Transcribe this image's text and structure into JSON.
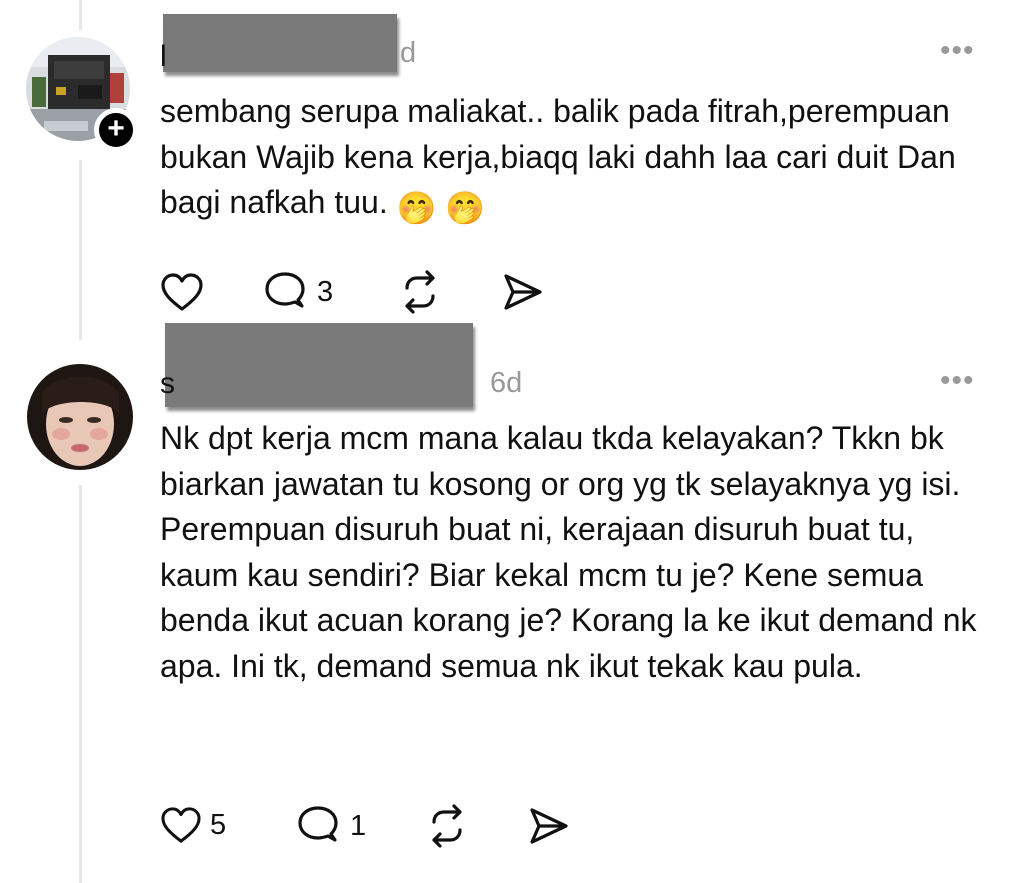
{
  "posts": [
    {
      "username_tail": "l",
      "timestamp": "d",
      "more_label": "•••",
      "text": "sembang serupa maliakat.. balik pada fitrah,perempuan bukan Wajib kena kerja,biaqq laki dahh laa cari duit Dan bagi nafkah tuu.",
      "emoji": [
        "🤭",
        "🤭"
      ],
      "follow_label": "+",
      "actions": {
        "like_count": "",
        "reply_count": "3",
        "repost_count": "",
        "share_count": ""
      }
    },
    {
      "username_tail": "s",
      "timestamp": "6d",
      "more_label": "•••",
      "text": "Nk dpt kerja mcm mana kalau tkda kelayakan? Tkkn bk biarkan jawatan tu kosong or org yg tk selayaknya yg isi. Perempuan disuruh buat ni, kerajaan disuruh buat tu, kaum kau sendiri? Biar kekal mcm tu je? Kene semua benda ikut acuan korang je? Korang la ke ikut demand nk apa. Ini tk, demand semua nk ikut tekak kau pula.",
      "actions": {
        "like_count": "5",
        "reply_count": "1",
        "repost_count": "",
        "share_count": ""
      }
    }
  ],
  "colors": {
    "redaction": "#7a7a7a",
    "muted": "#999999",
    "thread_line": "#e6e6e6"
  },
  "icons": [
    "heart-icon",
    "reply-icon",
    "repost-icon",
    "share-icon",
    "more-icon",
    "follow-plus-icon"
  ]
}
